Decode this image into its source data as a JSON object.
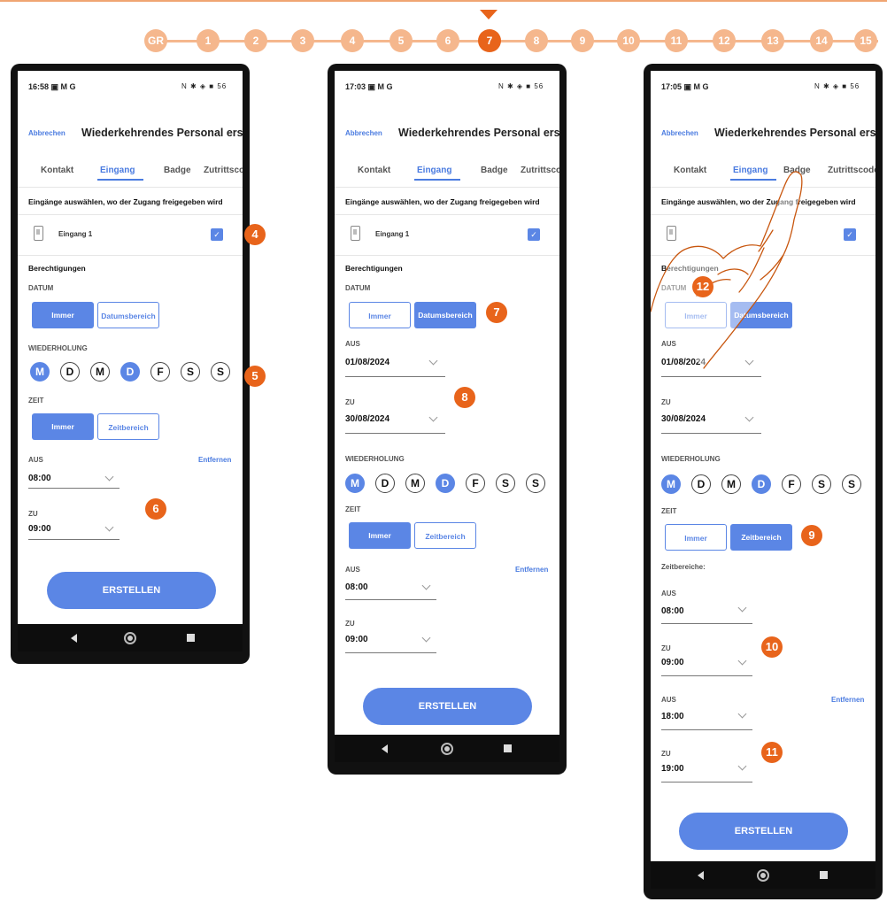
{
  "steps": {
    "items": [
      "GR",
      "1",
      "2",
      "3",
      "4",
      "5",
      "6",
      "7",
      "8",
      "9",
      "10",
      "11",
      "12",
      "13",
      "14",
      "15"
    ],
    "active": "7"
  },
  "common": {
    "cancel": "Abbrechen",
    "title": "Wiederkehrendes Personal erst..",
    "tabs": [
      "Kontakt",
      "Eingang",
      "Badge",
      "Zutrittscode"
    ],
    "active_tab": "Eingang",
    "entries_prompt": "Eingänge auswählen, wo der Zugang freigegeben wird",
    "entry_name": "Eingang 1",
    "permissions": "Berechtigungen",
    "datum": "DATUM",
    "immer": "Immer",
    "datumsbereich": "Datumsbereich",
    "wiederholung": "WIEDERHOLUNG",
    "days": [
      "M",
      "D",
      "M",
      "D",
      "F",
      "S",
      "S"
    ],
    "days_selected": [
      true,
      false,
      false,
      true,
      false,
      false,
      false
    ],
    "zeit": "ZEIT",
    "zeitbereich": "Zeitbereich",
    "aus": "AUS",
    "zu": "ZU",
    "entfernen": "Entfernen",
    "erstellen": "ERSTELLEN",
    "zeitbereiche": "Zeitbereiche:",
    "status_icons": "N ✱ ◈ ■ 56",
    "status_icons_1": "N ✱ ◈ ■ 56"
  },
  "phone1": {
    "time": "16:58 ▣ M G",
    "from_time": "08:00",
    "to_time": "09:00",
    "markers": [
      "4",
      "5",
      "6"
    ]
  },
  "phone2": {
    "time": "17:03 ▣ M G",
    "from_date": "01/08/2024",
    "to_date": "30/08/2024",
    "from_time": "08:00",
    "to_time": "09:00",
    "markers": [
      "7",
      "8"
    ]
  },
  "phone3": {
    "time": "17:05 ▣ M G",
    "from_date": "01/08/2024",
    "to_date": "30/08/2024",
    "range1_from": "08:00",
    "range1_to": "09:00",
    "range2_from": "18:00",
    "range2_to": "19:00",
    "markers": [
      "9",
      "10",
      "11",
      "12"
    ]
  }
}
